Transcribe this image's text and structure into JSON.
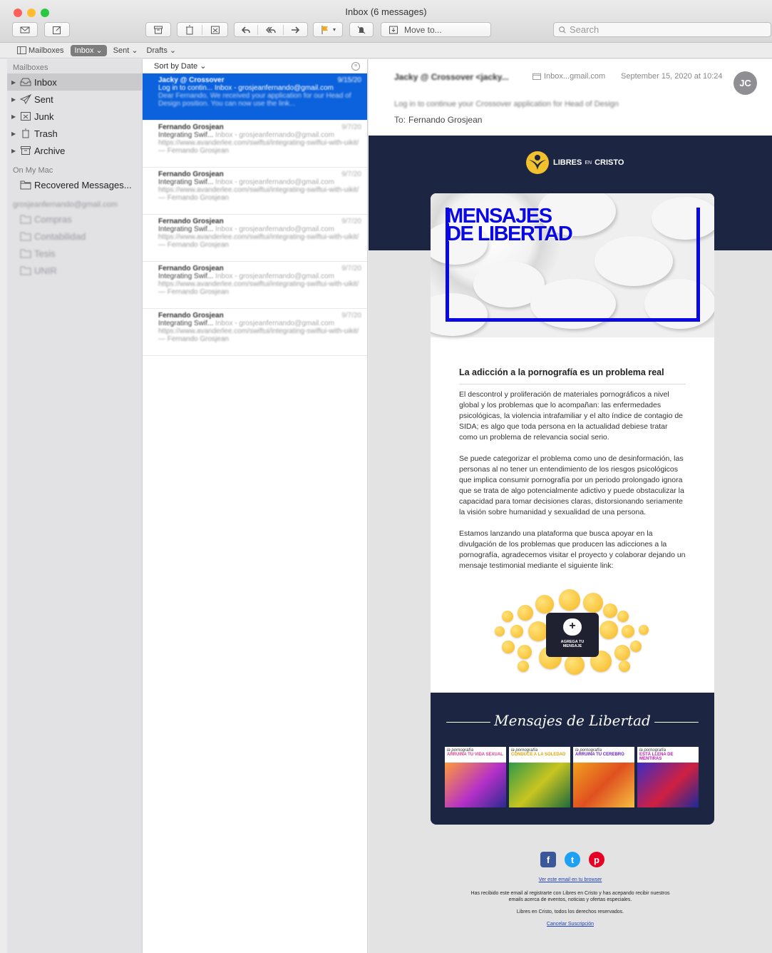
{
  "window": {
    "title": "Inbox (6 messages)"
  },
  "toolbar": {
    "move_to": "Move to...",
    "search_placeholder": "Search",
    "accent_flag": "#f5a623"
  },
  "favorites": {
    "mailboxes": "Mailboxes",
    "inbox": "Inbox",
    "sent": "Sent",
    "drafts": "Drafts"
  },
  "sidebar": {
    "mailboxes_header": "Mailboxes",
    "items": [
      {
        "label": "Inbox"
      },
      {
        "label": "Sent"
      },
      {
        "label": "Junk"
      },
      {
        "label": "Trash"
      },
      {
        "label": "Archive"
      }
    ],
    "onmymac_header": "On My Mac",
    "recovered": "Recovered Messages...",
    "account_header": "grosjeanfernando@gmail.com",
    "folders": [
      "Compras",
      "Contabilidad",
      "Tesis",
      "UNIR"
    ]
  },
  "list": {
    "sort_label": "Sort by Date",
    "messages": [
      {
        "from": "Jacky @ Crossover",
        "date": "9/15/20",
        "subject": "Log in to contin...",
        "mailbox": "Inbox - grosjeanfernando@gmail.com",
        "preview": "Dear Fernando, We received your application for our Head of Design position. You can now use the link..."
      },
      {
        "from": "Fernando Grosjean",
        "date": "9/7/20",
        "subject": "Integrating Swif...",
        "mailbox": "Inbox - grosjeanfernando@gmail.com",
        "preview": "https://www.avanderlee.com/swiftui/integrating-swiftui-with-uikit/ — Fernando Grosjean"
      },
      {
        "from": "Fernando Grosjean",
        "date": "9/7/20",
        "subject": "Integrating Swif...",
        "mailbox": "Inbox - grosjeanfernando@gmail.com",
        "preview": "https://www.avanderlee.com/swiftui/integrating-swiftui-with-uikit/ — Fernando Grosjean"
      },
      {
        "from": "Fernando Grosjean",
        "date": "9/7/20",
        "subject": "Integrating Swif...",
        "mailbox": "Inbox - grosjeanfernando@gmail.com",
        "preview": "https://www.avanderlee.com/swiftui/integrating-swiftui-with-uikit/ — Fernando Grosjean"
      },
      {
        "from": "Fernando Grosjean",
        "date": "9/7/20",
        "subject": "Integrating Swif...",
        "mailbox": "Inbox - grosjeanfernando@gmail.com",
        "preview": "https://www.avanderlee.com/swiftui/integrating-swiftui-with-uikit/ — Fernando Grosjean"
      },
      {
        "from": "Fernando Grosjean",
        "date": "9/7/20",
        "subject": "Integrating Swif...",
        "mailbox": "Inbox - grosjeanfernando@gmail.com",
        "preview": "https://www.avanderlee.com/swiftui/integrating-swiftui-with-uikit/ — Fernando Grosjean"
      }
    ]
  },
  "reader": {
    "from": "Jacky @ Crossover <jacky...",
    "mailbox": "Inbox...gmail.com",
    "date": "September 15, 2020 at 10:24",
    "avatar": "JC",
    "subject": "Log in to continue your Crossover application for Head of Design",
    "to_label": "To:",
    "to": "Fernando Grosjean"
  },
  "email": {
    "logo_a": "LIBRES",
    "logo_b": "EN",
    "logo_c": "CRISTO",
    "hero_line1": "MENSAJES",
    "hero_line2": "DE LIBERTAD",
    "article_title": "La adicción a la pornografía es un problema real",
    "p1": "El descontrol y proliferación de materiales pornográficos a nivel global y los problemas que lo acompañan: las enfermedades psicológicas, la violencia intrafamiliar y el alto índice de contagio de SIDA; es algo que toda persona en la actualidad debiese tratar como un problema de relevancia social serio.",
    "p2": "Se puede categorizar el problema como uno de desinformación, las personas al no tener un entendimiento de los riesgos psicológicos que implica consumir pornografía por un periodo prolongado ignora que se trata de algo potencialmente adictivo y puede obstaculizar la capacidad para tomar decisiones claras, distorsionando seriamente la visión sobre humanidad y sexualidad de una persona.",
    "p3": "Estamos lanzando una plataforma que busca apoyar en la divulgación de los problemas que producen las adicciones a la pornografía, agradecemos visitar el proyecto y colaborar dejando un mensaje testimonial mediante el siguiente link:",
    "cta_line1": "AGREGA TU",
    "cta_line2": "MENSAJE",
    "script_title": "Mensajes de Libertad",
    "posters": [
      {
        "kicker": "la pornografía",
        "headline": "ARRUINA TU VIDA SEXUAL",
        "color": "#e23e8c"
      },
      {
        "kicker": "la pornografía",
        "headline": "CONDUCE A LA SOLEDAD",
        "color": "#f2c200"
      },
      {
        "kicker": "la pornografía",
        "headline": "ARRUINA TU CEREBRO",
        "color": "#6a1fd0"
      },
      {
        "kicker": "la pornografía",
        "headline": "ESTÁ LLENA DE MENTIRAS",
        "color": "#c21bbf"
      }
    ],
    "view_in_browser": "Ver este email en tu browser",
    "fine1": "Has recibido este email al registrarte con Libres en Cristo y has acepando recibir nuestros",
    "fine2": "emails acerca de eventos, noticias y ofertas especiales.",
    "rights": "Libres en Cristo, todos los derechos reservados.",
    "unsubscribe": "Cancelar Suscripción"
  }
}
